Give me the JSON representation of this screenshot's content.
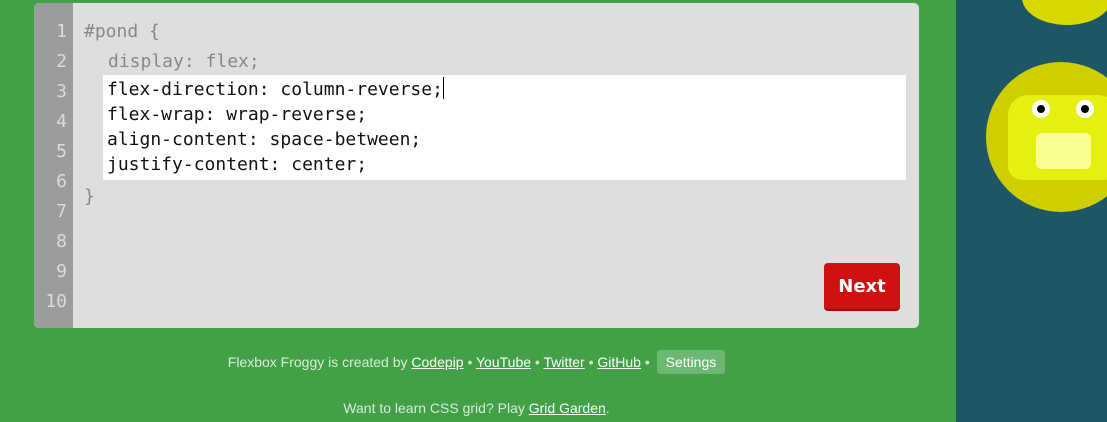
{
  "editor": {
    "line_numbers": [
      "1",
      "2",
      "3",
      "4",
      "5",
      "6",
      "7",
      "8",
      "9",
      "10"
    ],
    "code_open": "#pond {",
    "code_display": "display: flex;",
    "code_close": "}",
    "input_lines": [
      "flex-direction: column-reverse;",
      "flex-wrap: wrap-reverse;",
      "align-content: space-between;",
      "justify-content: center;"
    ],
    "next_label": "Next"
  },
  "footer": {
    "credit_prefix": "Flexbox Froggy is created by",
    "links": [
      "Codepip",
      "YouTube",
      "Twitter",
      "GitHub"
    ],
    "separator": "•",
    "settings_label": "Settings",
    "grid_prefix": "Want to learn CSS grid? Play",
    "grid_link": "Grid Garden",
    "grid_suffix": "."
  },
  "colors": {
    "background": "#42a147",
    "pond": "#1f5667",
    "next_button": "#d01111",
    "frog": "#e6f00f",
    "lilypad": "#cfcf00"
  },
  "icons": [
    "frog-icon",
    "lilypad-icon"
  ]
}
